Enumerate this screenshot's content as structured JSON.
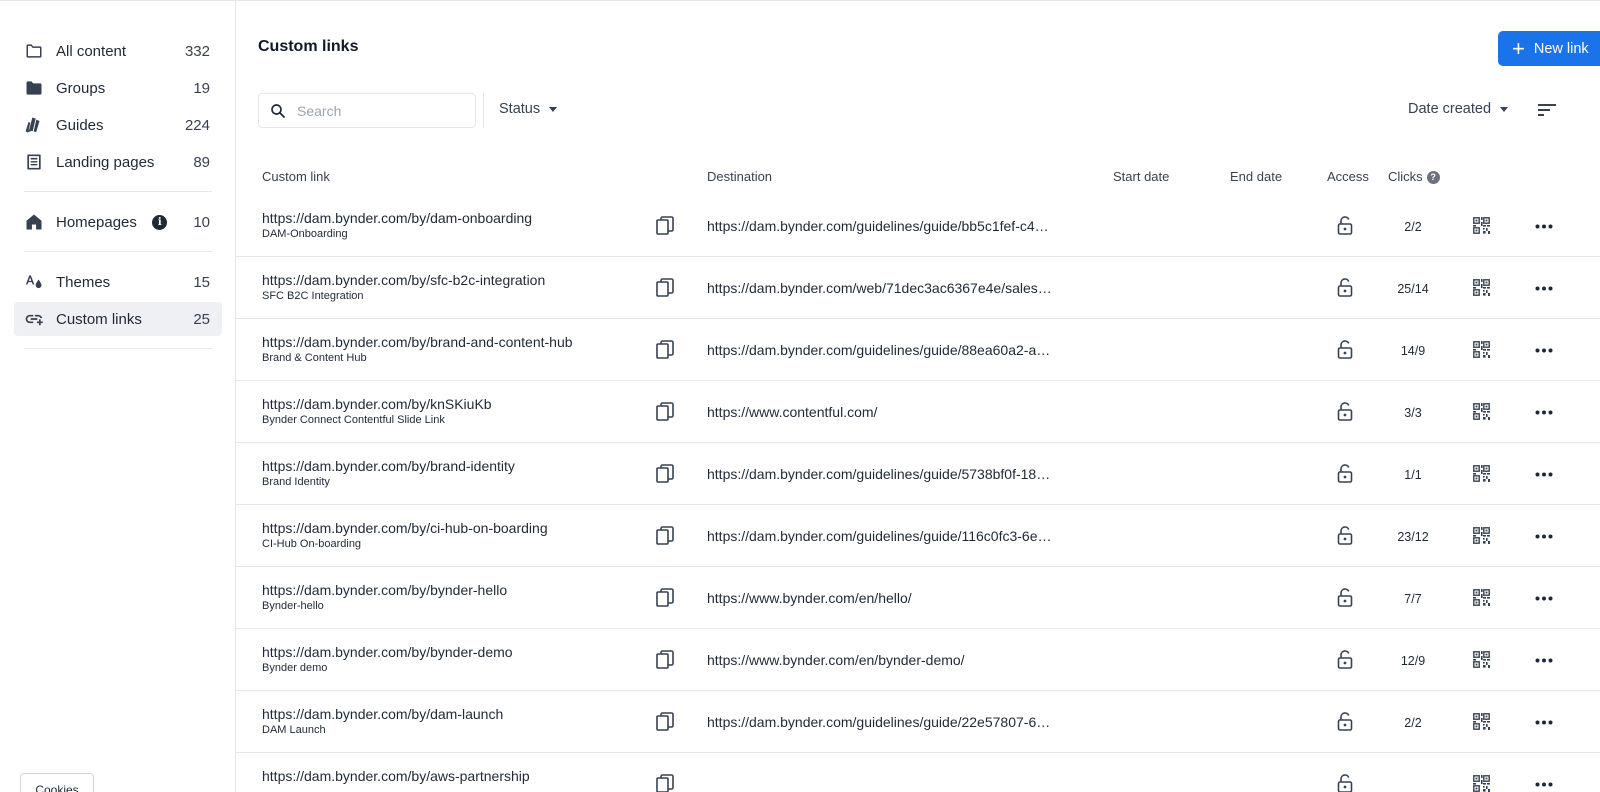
{
  "sidebar": {
    "items": [
      {
        "label": "All content",
        "count": "332",
        "icon": "folder-outline-icon"
      },
      {
        "label": "Groups",
        "count": "19",
        "icon": "folder-filled-icon"
      },
      {
        "label": "Guides",
        "count": "224",
        "icon": "guides-icon"
      },
      {
        "label": "Landing pages",
        "count": "89",
        "icon": "landing-page-icon"
      },
      {
        "label": "Homepages",
        "count": "10",
        "icon": "home-icon"
      },
      {
        "label": "Themes",
        "count": "15",
        "icon": "themes-icon"
      },
      {
        "label": "Custom links",
        "count": "25",
        "icon": "custom-link-icon",
        "active": true
      }
    ],
    "cookies_label": "Cookies"
  },
  "header": {
    "title": "Custom links",
    "new_link_label": "New link"
  },
  "toolbar": {
    "search_placeholder": "Search",
    "status_label": "Status",
    "sort_label": "Date created"
  },
  "table": {
    "columns": {
      "custom_link": "Custom link",
      "destination": "Destination",
      "start_date": "Start date",
      "end_date": "End date",
      "access": "Access",
      "clicks": "Clicks"
    },
    "rows": [
      {
        "url": "https://dam.bynder.com/by/dam-onboarding",
        "name": "DAM-Onboarding",
        "destination": "https://dam.bynder.com/guidelines/guide/bb5c1fef-c4…",
        "clicks": "2/2"
      },
      {
        "url": "https://dam.bynder.com/by/sfc-b2c-integration",
        "name": "SFC B2C Integration",
        "destination": "https://dam.bynder.com/web/71dec3ac6367e4e/sales…",
        "clicks": "25/14"
      },
      {
        "url": "https://dam.bynder.com/by/brand-and-content-hub",
        "name": "Brand & Content Hub",
        "destination": "https://dam.bynder.com/guidelines/guide/88ea60a2-a…",
        "clicks": "14/9"
      },
      {
        "url": "https://dam.bynder.com/by/knSKiuKb",
        "name": "Bynder Connect Contentful Slide Link",
        "destination": "https://www.contentful.com/",
        "clicks": "3/3"
      },
      {
        "url": "https://dam.bynder.com/by/brand-identity",
        "name": "Brand Identity",
        "destination": "https://dam.bynder.com/guidelines/guide/5738bf0f-18…",
        "clicks": "1/1"
      },
      {
        "url": "https://dam.bynder.com/by/ci-hub-on-boarding",
        "name": "CI-Hub On-boarding",
        "destination": "https://dam.bynder.com/guidelines/guide/116c0fc3-6e…",
        "clicks": "23/12"
      },
      {
        "url": "https://dam.bynder.com/by/bynder-hello",
        "name": "Bynder-hello",
        "destination": "https://www.bynder.com/en/hello/",
        "clicks": "7/7"
      },
      {
        "url": "https://dam.bynder.com/by/bynder-demo",
        "name": "Bynder demo",
        "destination": "https://www.bynder.com/en/bynder-demo/",
        "clicks": "12/9"
      },
      {
        "url": "https://dam.bynder.com/by/dam-launch",
        "name": "DAM Launch",
        "destination": "https://dam.bynder.com/guidelines/guide/22e57807-6…",
        "clicks": "2/2"
      },
      {
        "url": "https://dam.bynder.com/by/aws-partnership",
        "name": "",
        "destination": "",
        "clicks": ""
      }
    ]
  }
}
